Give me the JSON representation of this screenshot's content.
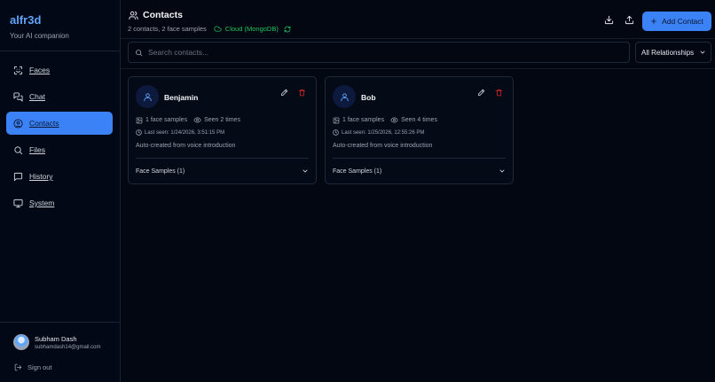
{
  "brand": {
    "title": "alfr3d",
    "subtitle": "Your AI companion"
  },
  "sidebar": {
    "items": [
      {
        "label": "Faces",
        "icon": "face-scan-icon"
      },
      {
        "label": "Chat",
        "icon": "chat-icon"
      },
      {
        "label": "Contacts",
        "icon": "contacts-icon",
        "active": true
      },
      {
        "label": "Files",
        "icon": "search-icon"
      },
      {
        "label": "History",
        "icon": "history-icon"
      },
      {
        "label": "System",
        "icon": "monitor-icon"
      }
    ]
  },
  "user": {
    "name": "Subham Dash",
    "email": "subhamdash14@gmail.com"
  },
  "signout": {
    "label": "Sign out"
  },
  "header": {
    "title": "Contacts",
    "summary": "2 contacts, 2 face samples",
    "storage": "Cloud (MongoDB)",
    "add_label": "Add Contact"
  },
  "search": {
    "placeholder": "Search contacts...",
    "value": ""
  },
  "filter": {
    "selected": "All Relationships"
  },
  "contacts": [
    {
      "name": "Benjamin",
      "face_samples": "1 face samples",
      "seen": "Seen 2 times",
      "last_seen": "Last seen: 1/24/2026, 3:51:15 PM",
      "notes": "Auto-created from voice introduction",
      "samples_label": "Face Samples (1)"
    },
    {
      "name": "Bob",
      "face_samples": "1 face samples",
      "seen": "Seen 4 times",
      "last_seen": "Last seen: 1/25/2026, 12:55:26 PM",
      "notes": "Auto-created from voice introduction",
      "samples_label": "Face Samples (1)"
    }
  ],
  "colors": {
    "accent": "#3b82f6",
    "brand": "#60a5fa",
    "success": "#22c55e",
    "danger": "#dc2626",
    "background": "#030712"
  }
}
